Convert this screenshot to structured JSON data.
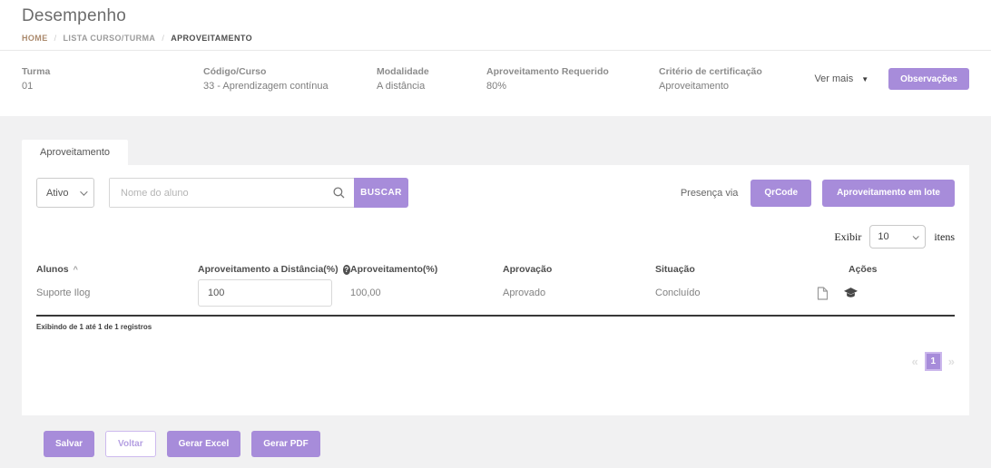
{
  "page": {
    "title": "Desempenho",
    "separator": "/",
    "breadcrumb": {
      "home": "HOME",
      "mid": "LISTA CURSO/TURMA",
      "current": "APROVEITAMENTO"
    }
  },
  "info_bar": {
    "fields": [
      {
        "label": "Turma",
        "value": "01"
      },
      {
        "label": "Código/Curso",
        "value": "33 - Aprendizagem contínua"
      },
      {
        "label": "Modalidade",
        "value": "A distância"
      },
      {
        "label": "Aproveitamento Requerido",
        "value": "80%"
      },
      {
        "label": "Critério de certificação",
        "value": "Aproveitamento"
      }
    ],
    "ver_mais": "Ver mais",
    "observacoes": "Observações"
  },
  "card": {
    "tab": "Aproveitamento",
    "filters": {
      "status_value": "Ativo",
      "search_placeholder": "Nome do aluno",
      "buscar": "BUSCAR",
      "presenca_via": "Presença via",
      "qrcode": "QrCode",
      "lote": "Aproveitamento em lote"
    },
    "page_size": {
      "exibir": "Exibir",
      "value": "10",
      "itens": "itens"
    },
    "table": {
      "columns": [
        "Alunos",
        "Aproveitamento a Distância(%)",
        "Aproveitamento(%)",
        "Aprovação",
        "Situação",
        "Ações"
      ],
      "row": {
        "aluno": "Suporte Ilog",
        "aproveitamento_distancia": "100",
        "aproveitamento": "100,00",
        "aprovacao": "Aprovado",
        "situacao": "Concluído"
      },
      "summary": "Exibindo de 1 até 1 de 1 registros"
    },
    "pagination": {
      "prev": "«",
      "page": "1",
      "next": "»"
    }
  },
  "footer": {
    "salvar": "Salvar",
    "voltar": "Voltar",
    "gerar_excel": "Gerar Excel",
    "gerar_pdf": "Gerar PDF"
  },
  "icons": {
    "ver_mais_caret": "▼",
    "sort_asc": "^",
    "help": "?",
    "search": "magnifier-svg",
    "document_action": "document-svg",
    "certificate_action": "graduation-cap-svg",
    "select_chevron": "css-chevron"
  },
  "colors": {
    "accent_purple": "#a78cda",
    "accent_purple_light": "#cbb7ec",
    "breadcrumb_home": "#ab8a6d",
    "table_divider": "#383838"
  }
}
